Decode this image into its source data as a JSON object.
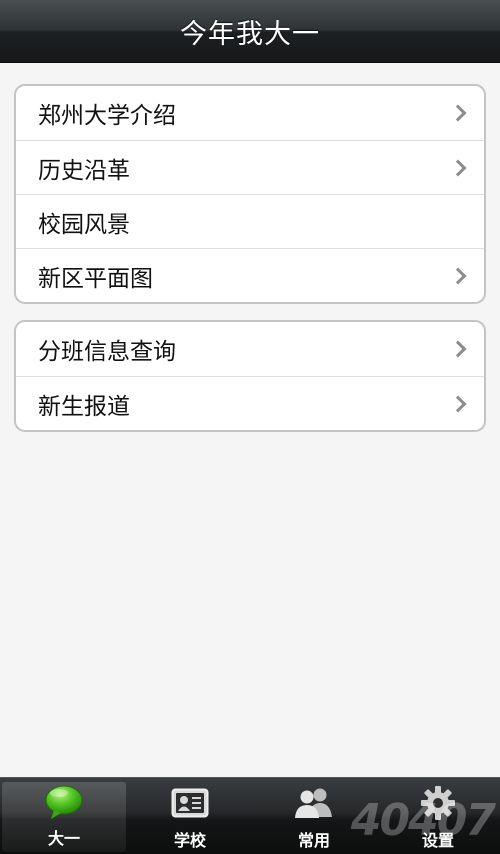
{
  "header": {
    "title": "今年我大一"
  },
  "groups": [
    {
      "items": [
        {
          "label": "郑州大学介绍",
          "chevron": true
        },
        {
          "label": "历史沿革",
          "chevron": true
        },
        {
          "label": "校园风景",
          "chevron": false
        },
        {
          "label": "新区平面图",
          "chevron": true
        }
      ]
    },
    {
      "items": [
        {
          "label": "分班信息查询",
          "chevron": true
        },
        {
          "label": "新生报道",
          "chevron": true
        }
      ]
    }
  ],
  "tabbar": {
    "tabs": [
      {
        "label": "大一",
        "icon": "chat-bubble-icon",
        "active": true
      },
      {
        "label": "学校",
        "icon": "id-card-icon",
        "active": false
      },
      {
        "label": "常用",
        "icon": "users-icon",
        "active": false
      },
      {
        "label": "设置",
        "icon": "gear-icon",
        "active": false
      }
    ]
  },
  "watermark": {
    "text": "40407"
  },
  "colors": {
    "accent_green": "#4cc21f",
    "header_dark": "#2f3336",
    "chevron_gray": "#8c8c8c"
  }
}
